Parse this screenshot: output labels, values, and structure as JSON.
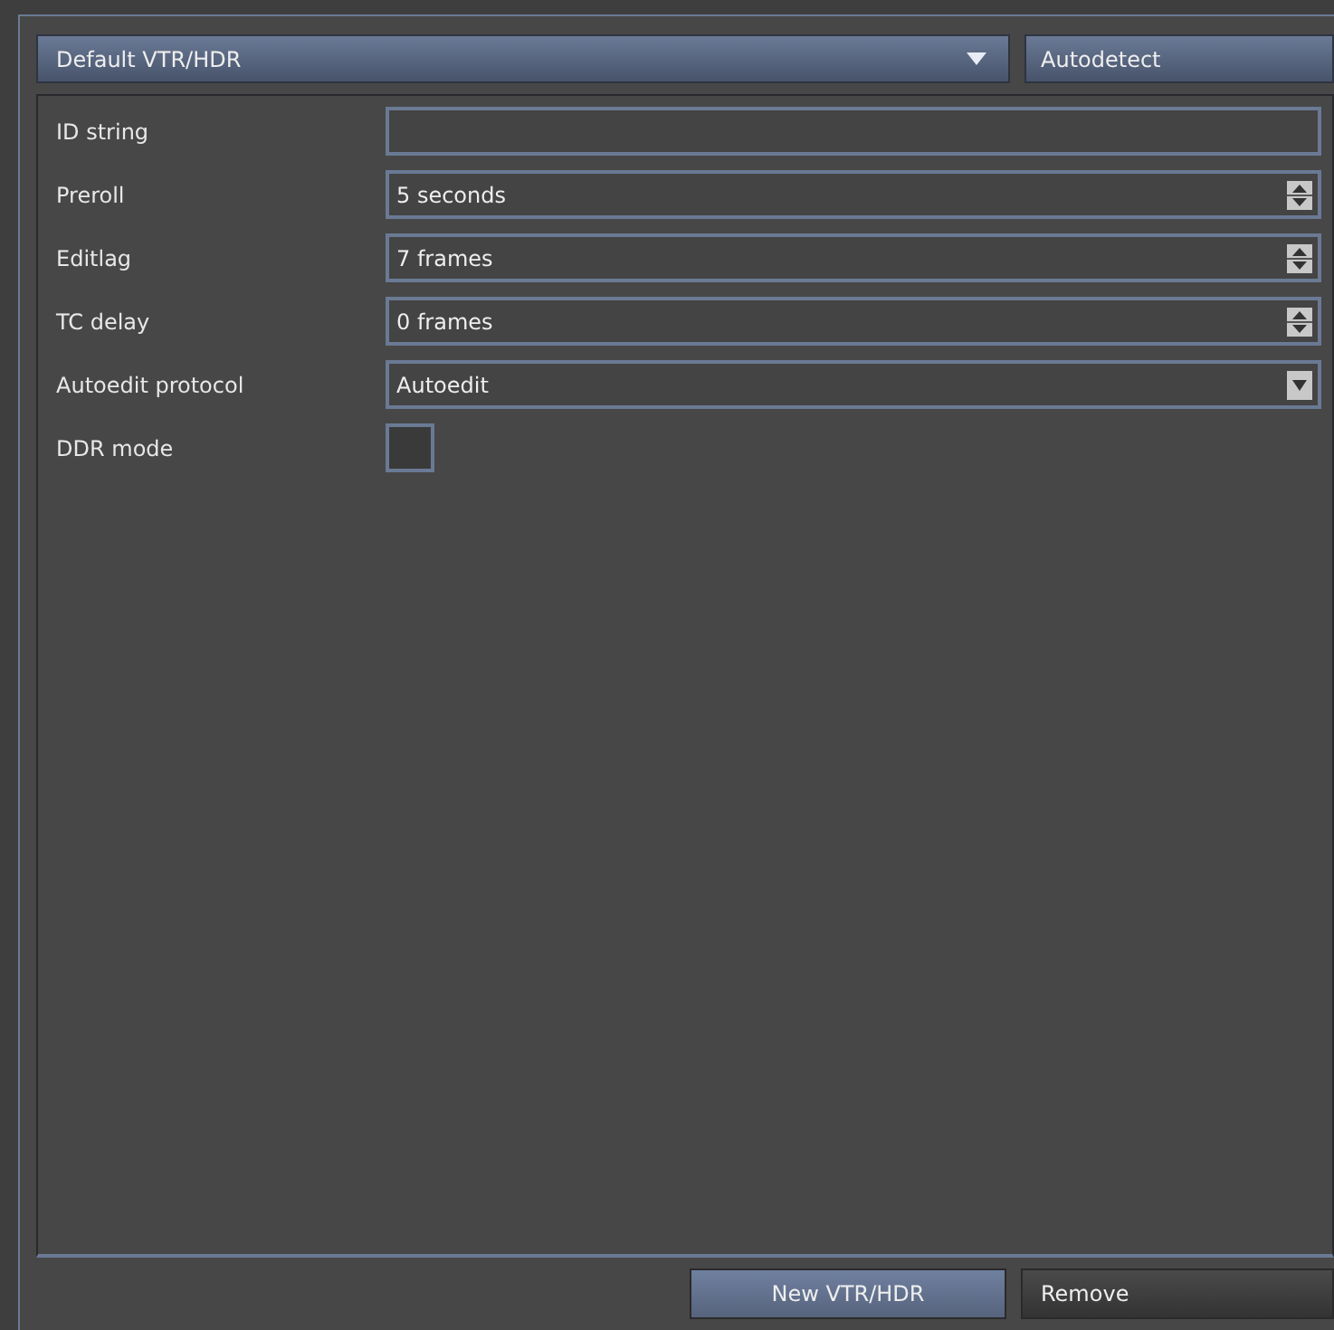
{
  "device_select": {
    "value": "Default VTR/HDR"
  },
  "autodetect_button": {
    "label": "Autodetect"
  },
  "settings": [
    {
      "label": "ID string",
      "kind": "text"
    },
    {
      "label": "Preroll",
      "kind": "spinner",
      "value": "5 seconds"
    },
    {
      "label": "Editlag",
      "kind": "spinner",
      "value": "7 frames"
    },
    {
      "label": "TC delay",
      "kind": "spinner",
      "value": "0 frames"
    },
    {
      "label": "Autoedit protocol",
      "kind": "select",
      "value": "Autoedit"
    },
    {
      "label": "DDR mode",
      "kind": "checkbox",
      "checked": false
    }
  ],
  "buttons": [
    {
      "label": "New VTR/HDR",
      "primary": true
    },
    {
      "label": "Remove",
      "primary": false
    }
  ]
}
